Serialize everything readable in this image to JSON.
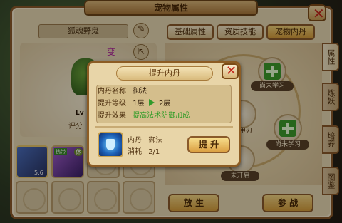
{
  "header": {
    "title": "宠物属性"
  },
  "pet": {
    "name": "狐魂野鬼",
    "score_label": "评分",
    "char_a": "变",
    "char_b": "Lv"
  },
  "tabs": [
    {
      "label": "基础属性"
    },
    {
      "label": "资质技能"
    },
    {
      "label": "宠物内丹",
      "active": true
    }
  ],
  "side_tabs": [
    {
      "label": "属性",
      "active": true
    },
    {
      "label": "炼妖"
    },
    {
      "label": "培养"
    },
    {
      "label": "图鉴"
    }
  ],
  "slots": {
    "pet1_level": "5.6",
    "pet2_badge": "携带",
    "pet2_tag": "休"
  },
  "dan_nodes": {
    "unlearned_a": "尚未学习",
    "unlearned_b": "尚未学习",
    "partial_label": "甲刃",
    "locked": "未开启"
  },
  "buttons": {
    "release": "放 生",
    "battle": "参 战"
  },
  "dialog": {
    "title": "提升内丹",
    "name_label": "内丹名称",
    "name_value": "御法",
    "level_label": "提升等级",
    "level_from": "1层",
    "level_to": "2层",
    "effect_label": "提升效果",
    "effect_value": "提高法术防御加成",
    "item_label": "内丹",
    "item_name": "御法",
    "cost_label": "消耗",
    "cost_value": "2/1",
    "upgrade_button": "提 升"
  },
  "colors": {
    "effect_green": "#2a9b23",
    "close_red": "#c3261b",
    "accent_gold": "#d69c3a"
  },
  "icons": [
    "pencil-icon",
    "share-icon",
    "close-icon",
    "plus-icon",
    "shield-icon",
    "arrow-right-icon"
  ]
}
